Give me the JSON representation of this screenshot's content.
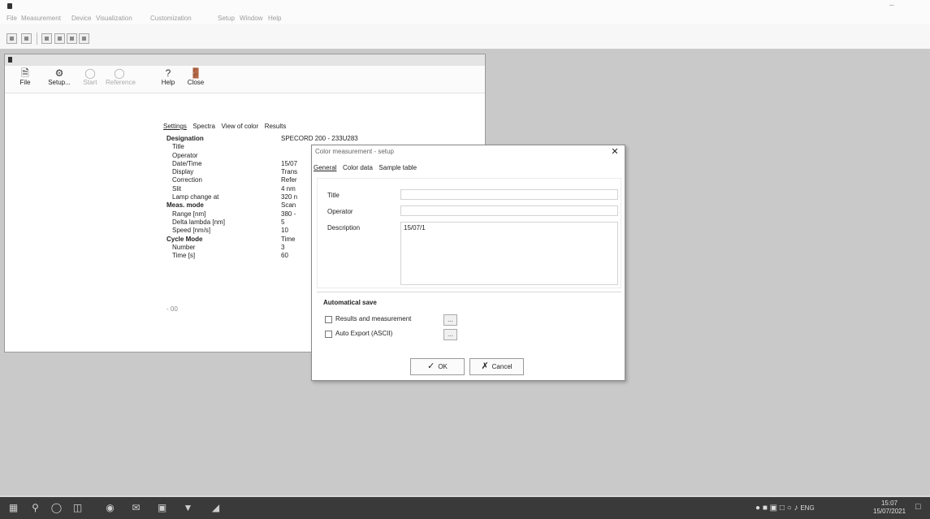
{
  "app": {
    "menu": [
      "File",
      "Measurement",
      "Device",
      "Visualization",
      "Customization",
      "Setup",
      "Window",
      "Help"
    ]
  },
  "child_toolbar": {
    "buttons": [
      {
        "label": "File",
        "icon": "file-icon"
      },
      {
        "label": "Setup...",
        "icon": "setup-icon"
      },
      {
        "label": "Start",
        "icon": "start-icon"
      },
      {
        "label": "Reference",
        "icon": "reference-icon"
      },
      {
        "label": "Help",
        "icon": "help-icon"
      },
      {
        "label": "Close",
        "icon": "close-icon"
      }
    ]
  },
  "settings": {
    "tabs": [
      "Settings",
      "Spectra",
      "View of color",
      "Results"
    ],
    "rows": [
      {
        "key": "Designation",
        "value": "SPECORD 200 - 233U283",
        "level": "group"
      },
      {
        "key": "Title",
        "value": "",
        "level": "child"
      },
      {
        "key": "Operator",
        "value": "",
        "level": "child"
      },
      {
        "key": "Date/Time",
        "value": "15/07",
        "level": "child"
      },
      {
        "key": "Display",
        "value": "Trans",
        "level": "child"
      },
      {
        "key": "Correction",
        "value": "Refer",
        "level": "child"
      },
      {
        "key": "Slit",
        "value": "4 nm",
        "level": "child"
      },
      {
        "key": "Lamp change at",
        "value": "320 n",
        "level": "child"
      },
      {
        "key": "Meas. mode",
        "value": "Scan",
        "level": "group"
      },
      {
        "key": "Range [nm]",
        "value": "380 -",
        "level": "child"
      },
      {
        "key": "Delta lambda [nm]",
        "value": "5",
        "level": "child"
      },
      {
        "key": "Speed [nm/s]",
        "value": "10",
        "level": "child"
      },
      {
        "key": "Cycle Mode",
        "value": "Time",
        "level": "group"
      },
      {
        "key": "Number",
        "value": "3",
        "level": "child"
      },
      {
        "key": "Time [s]",
        "value": "60",
        "level": "child"
      }
    ],
    "footer": "- 00"
  },
  "dialog": {
    "title": "Color measurement - setup",
    "tabs": [
      "General",
      "Color data",
      "Sample table"
    ],
    "fields": {
      "title_label": "Title",
      "title_value": "",
      "operator_label": "Operator",
      "operator_value": "",
      "description_label": "Description",
      "description_value": "15/07/1"
    },
    "autosave": {
      "heading": "Automatical save",
      "results_label": "Results and measurement",
      "export_label": "Auto Export (ASCII)",
      "browse_label": "..."
    },
    "ok_label": "OK",
    "cancel_label": "Cancel"
  },
  "taskbar": {
    "lang": "ENG",
    "time": "15:07",
    "date": "15/07/2021"
  }
}
